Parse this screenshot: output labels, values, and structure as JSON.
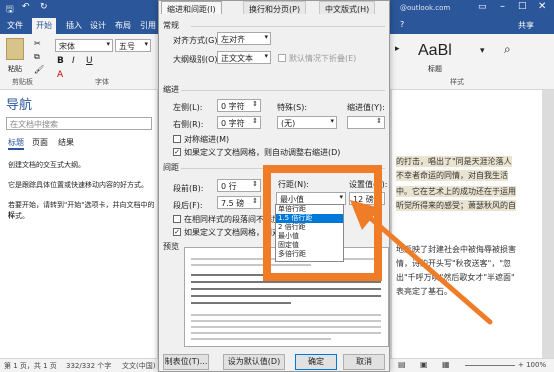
{
  "word": {
    "file_tab": "文件",
    "tabs": [
      "开始",
      "插入",
      "设计",
      "布局",
      "引用"
    ],
    "share": "共享",
    "search_hint": "@outlook.com",
    "font_name": "宋体",
    "font_size": "五号",
    "style_preview": "AaBl",
    "style_name": "标题",
    "group_clipboard": "剪贴板",
    "group_font": "字体",
    "group_styles": "样式",
    "paste_icon": "paste-icon"
  },
  "nav": {
    "title": "导航",
    "search_placeholder": "在文档中搜索",
    "tabs": [
      "标题",
      "页面",
      "结果"
    ],
    "lines": [
      "创建文档的交互式大纲。",
      "它是跟踪具体位置或快速移动内容的好方式。",
      "若要开始，请转到\"开始\"选项卡，并向文档中的标",
      "样式。"
    ]
  },
  "doc": {
    "lines": [
      "的打击，唱出了\"同是天涯沦落人",
      "不幸者命运的同情，对自我生活",
      "中。它在艺术上的成功还在于运用",
      "听觉所得来的感受；萧瑟秋风的自",
      "地反映了封建社会中被侮辱被损害",
      "情，诗的开头写\"秋夜送客\"，\"忽",
      "出\"千呼万唤\"然后歌女才\"半遮面\"",
      "表亮定了基石。"
    ]
  },
  "status": {
    "page": "第 1 页，共 1 页",
    "words": "332/332 个字",
    "lang": "文文(中国)",
    "zoom": "+ 100%"
  },
  "dialog": {
    "tabs": [
      "缩进和间距(I)",
      "换行和分页(P)",
      "中文版式(H)"
    ],
    "general": "常规",
    "align_label": "对齐方式(G):",
    "align_value": "左对齐",
    "outline_label": "大纲级别(O):",
    "outline_value": "正文文本",
    "collapse_label": "默认情况下折叠(E)",
    "indent": "缩进",
    "left_label": "左侧(L):",
    "left_value": "0 字符",
    "right_label": "右侧(R):",
    "right_value": "0 字符",
    "special_label": "特殊(S):",
    "special_value": "(无)",
    "indent_value_label": "缩进值(Y):",
    "mirror_label": "对称缩进(M)",
    "auto_indent_label": "如果定义了文档网格，则自动调整右缩进(D)",
    "spacing": "间距",
    "before_label": "段前(B):",
    "before_value": "0 行",
    "after_label": "段后(F):",
    "after_value": "7.5 磅",
    "linespacing_label": "行距(N):",
    "linespacing_value": "最小值",
    "setvalue_label": "设置值(A):",
    "setvalue_value": "12 磅",
    "nospace_label": "在相同样式的段落间不添加",
    "grid_label": "如果定义了文档网格，则对",
    "preview": "预览",
    "options": [
      "单倍行距",
      "1.5 倍行距",
      "2 倍行距",
      "最小值",
      "固定值",
      "多倍行距"
    ],
    "selected_index": 1,
    "tabs_button": "制表位(T)...",
    "default_button": "设为默认值(D)",
    "ok_button": "确定",
    "cancel_button": "取消"
  },
  "colors": {
    "word_blue": "#2b579a",
    "highlight": "#f07c27",
    "selection": "#0078d7"
  }
}
